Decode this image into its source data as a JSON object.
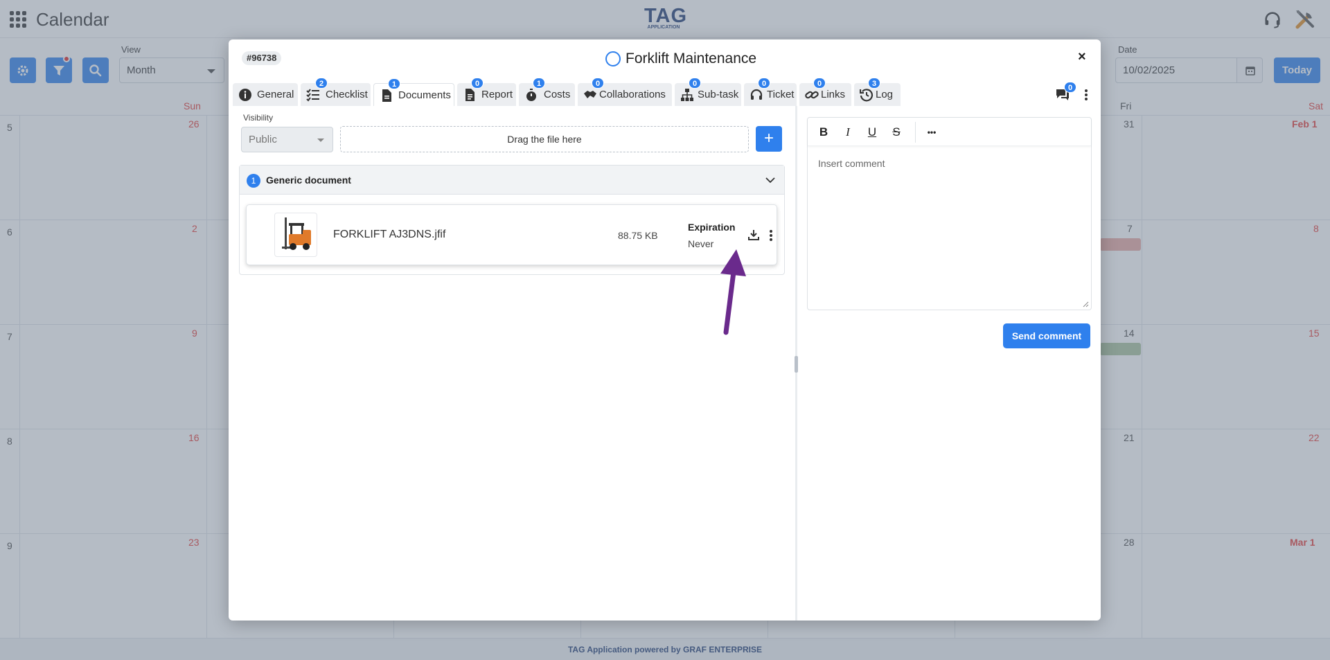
{
  "app": {
    "title": "Calendar",
    "logo_text": "TAG",
    "logo_subtext": "APPLICATION",
    "footer": "TAG Application powered by GRAF ENTERPRISE"
  },
  "calendar": {
    "view_label": "View",
    "view_value": "Month",
    "date_label": "Date",
    "date_value": "10/02/2025",
    "today_label": "Today",
    "days": {
      "sun": "Sun",
      "fri": "Fri",
      "sat": "Sat"
    },
    "weeks": [
      {
        "num": "5",
        "sun": "26",
        "fri": "31",
        "sat": "Feb 1"
      },
      {
        "num": "6",
        "sun": "2",
        "fri": "7",
        "sat": "8"
      },
      {
        "num": "7",
        "sun": "9",
        "fri": "14",
        "sat": "15"
      },
      {
        "num": "8",
        "sun": "16",
        "fri": "21",
        "sat": "22"
      },
      {
        "num": "9",
        "sun": "23",
        "fri": "28",
        "sat": "Mar 1"
      }
    ],
    "event_colors": {
      "week6": "#e9a8a3",
      "week7": "#a9c39d"
    }
  },
  "modal": {
    "ticket_id": "#96738",
    "title": "Forklift Maintenance",
    "close": "×",
    "tabs": [
      {
        "label": "General",
        "badge": ""
      },
      {
        "label": "Checklist",
        "badge": "2"
      },
      {
        "label": "Documents",
        "badge": "1"
      },
      {
        "label": "Report",
        "badge": "0"
      },
      {
        "label": "Costs",
        "badge": "1"
      },
      {
        "label": "Collaborations",
        "badge": "0"
      },
      {
        "label": "Sub-task",
        "badge": "0"
      },
      {
        "label": "Ticket",
        "badge": "0"
      },
      {
        "label": "Links",
        "badge": "0"
      },
      {
        "label": "Log",
        "badge": "3"
      }
    ],
    "comments_count": "0",
    "documents": {
      "visibility_label": "Visibility",
      "visibility_value": "Public",
      "dropzone_text": "Drag the file here",
      "add_label": "+",
      "group": {
        "count": "1",
        "title": "Generic document",
        "files": [
          {
            "name": "FORKLIFT AJ3DNS.jfif",
            "size": "88.75 KB",
            "expiration_label": "Expiration",
            "expiration_value": "Never"
          }
        ]
      }
    },
    "comments": {
      "toolbar": {
        "bold": "B",
        "italic": "I",
        "underline": "U",
        "strike": "S",
        "more": "•••"
      },
      "placeholder": "Insert comment",
      "send_label": "Send comment"
    }
  },
  "colors": {
    "primary": "#2f80ed",
    "holiday_red": "#e53935",
    "annotation_arrow": "#6a2a8c"
  }
}
